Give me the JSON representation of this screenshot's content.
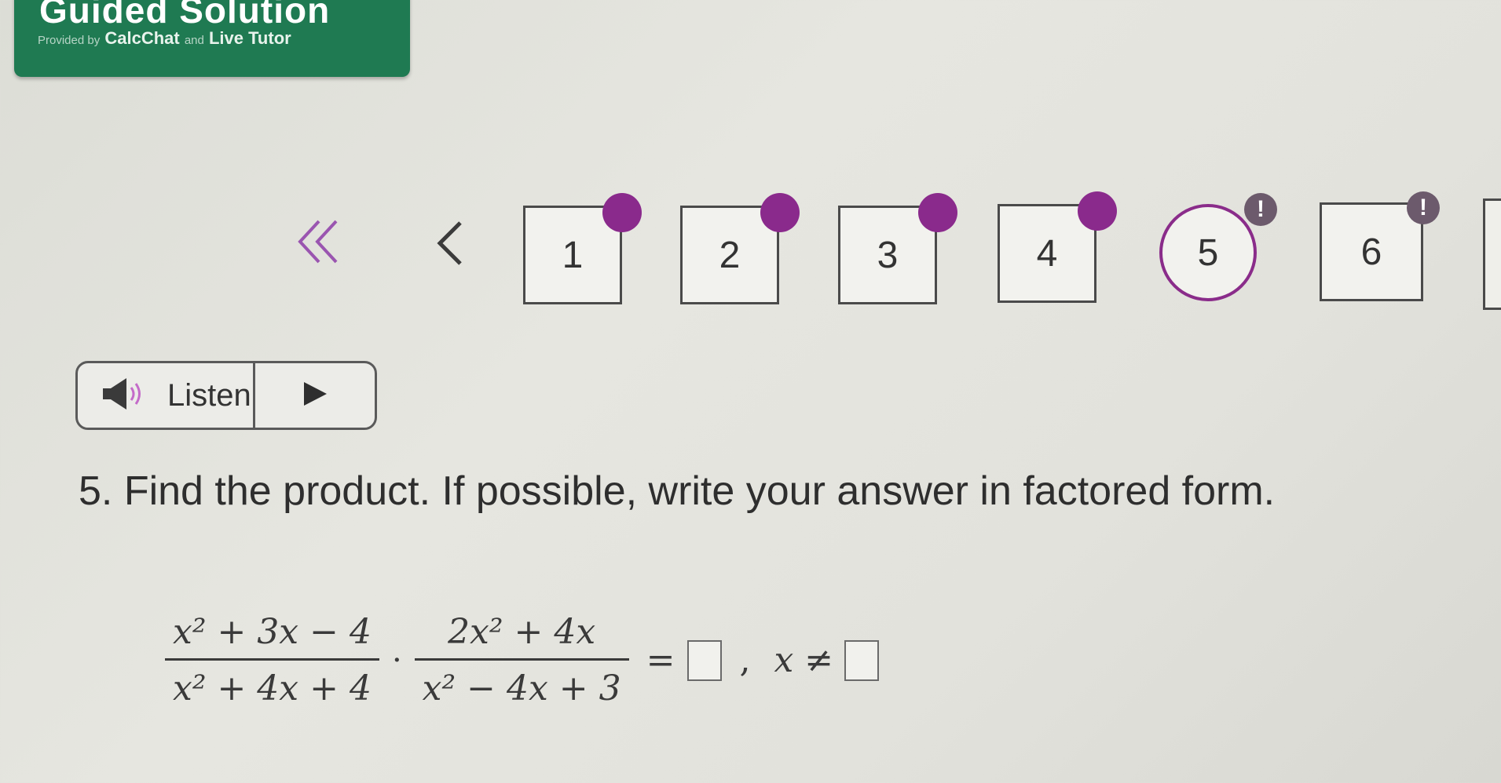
{
  "banner": {
    "title": "Guided Solution",
    "provided_by": "Provided by",
    "calcchat": "CalcChat",
    "and": "and",
    "live_tutor": "Live Tutor"
  },
  "nav": {
    "first_icon": "double-chevron-left-icon",
    "prev_icon": "chevron-left-icon",
    "questions": [
      {
        "label": "1",
        "status": "answered"
      },
      {
        "label": "2",
        "status": "answered"
      },
      {
        "label": "3",
        "status": "answered"
      },
      {
        "label": "4",
        "status": "answered"
      },
      {
        "label": "5",
        "status": "current-alert"
      },
      {
        "label": "6",
        "status": "alert"
      }
    ],
    "alert_glyph": "!"
  },
  "listen": {
    "label": "Listen",
    "speaker_icon": "speaker-icon",
    "play_icon": "play-icon"
  },
  "question": {
    "text": "5. Find the product. If possible, write your answer in factored form."
  },
  "math": {
    "frac1": {
      "num": "x² + 3x − 4",
      "den": "x² + 4x + 4"
    },
    "frac2": {
      "num": "2x² + 4x",
      "den": "x² − 4x + 3"
    },
    "times": "·",
    "equals": "=",
    "comma": ",",
    "restriction": "x ≠"
  },
  "colors": {
    "banner": "#1f7a52",
    "accent": "#8a2a8c"
  }
}
